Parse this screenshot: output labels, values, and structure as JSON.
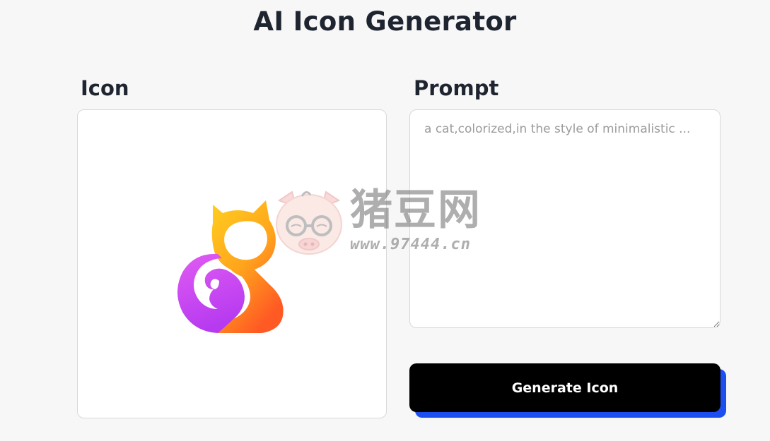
{
  "app": {
    "title": "AI Icon Generator"
  },
  "icon_section": {
    "label": "Icon",
    "preview_icon": "gradient-cat-icon"
  },
  "prompt_section": {
    "label": "Prompt",
    "placeholder": "a cat,colorized,in the style of minimalistic ...",
    "value": ""
  },
  "actions": {
    "generate_label": "Generate Icon"
  },
  "watermark": {
    "text": "猪豆网",
    "url": "www.97444.cn",
    "icon": "pig-face-glasses-icon"
  },
  "colors": {
    "background": "#f7f7f7",
    "button": "#000000",
    "button_shadow": "#1d4ff0",
    "cat_gradient_start": "#ffc21a",
    "cat_gradient_end": "#ff5a1f",
    "tail_gradient_start": "#e85cf2",
    "tail_gradient_end": "#b63af0"
  }
}
